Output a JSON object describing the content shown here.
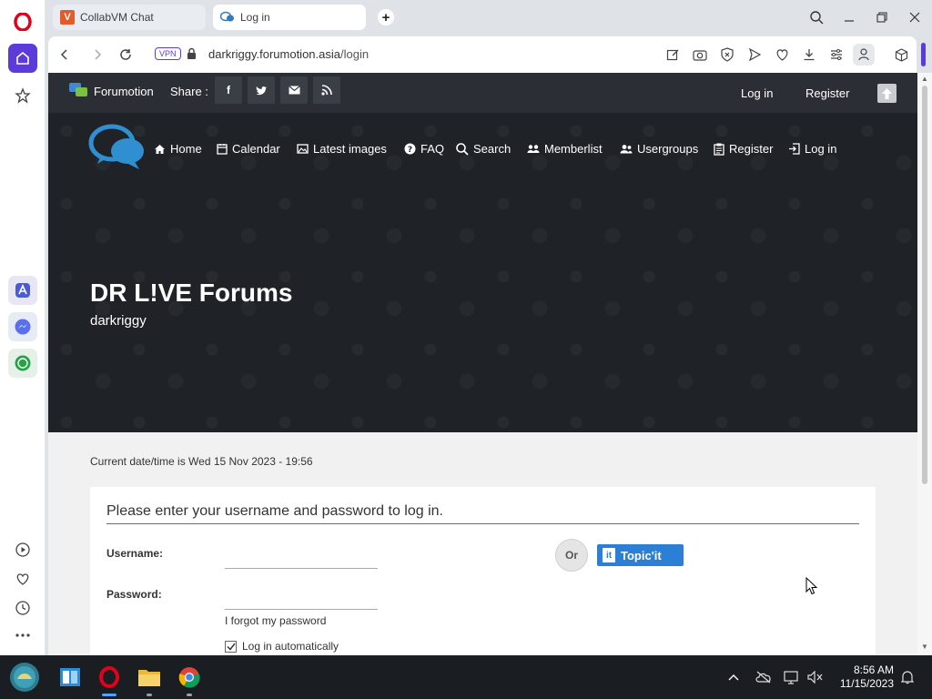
{
  "browser": {
    "tabs": [
      {
        "label": "CollabVM Chat"
      },
      {
        "label": "Log in"
      }
    ],
    "address": {
      "vpn": "VPN",
      "host": "darkriggy.forumotion.asia",
      "path": "/login"
    }
  },
  "forumotion_bar": {
    "brand": "Forumotion",
    "share_label": "Share :",
    "share_buttons": [
      "f",
      "twitter",
      "email",
      "rss"
    ],
    "links": {
      "login": "Log in",
      "register": "Register"
    }
  },
  "site": {
    "nav": [
      {
        "label": "Home",
        "icon": "home-icon"
      },
      {
        "label": "Calendar",
        "icon": "calendar-icon"
      },
      {
        "label": "Latest images",
        "icon": "image-icon"
      },
      {
        "label": "FAQ",
        "icon": "question-icon"
      },
      {
        "label": "Search",
        "icon": "search-icon"
      },
      {
        "label": "Memberlist",
        "icon": "members-icon"
      },
      {
        "label": "Usergroups",
        "icon": "usergroups-icon"
      },
      {
        "label": "Register",
        "icon": "register-icon"
      },
      {
        "label": "Log in",
        "icon": "login-icon"
      }
    ],
    "title": "DR L!VE Forums",
    "subtitle": "darkriggy"
  },
  "content": {
    "datetime": "Current date/time is Wed 15 Nov 2023 - 19:56",
    "login": {
      "heading": "Please enter your username and password to log in.",
      "username_label": "Username:",
      "password_label": "Password:",
      "forgot": "I forgot my password",
      "auto_login": "Log in automatically",
      "auto_login_checked": true,
      "or": "Or",
      "topicit": "Topic'it",
      "topicit_badge": "it"
    }
  },
  "taskbar": {
    "time": "8:56 AM",
    "date": "11/15/2023"
  },
  "colors": {
    "opera_accent": "#5b3cdb",
    "forum_bar": "#2b2f35",
    "hero_bg": "#1f2327",
    "topicit_blue": "#2b7fd4",
    "taskbar": "#1a1e22"
  }
}
